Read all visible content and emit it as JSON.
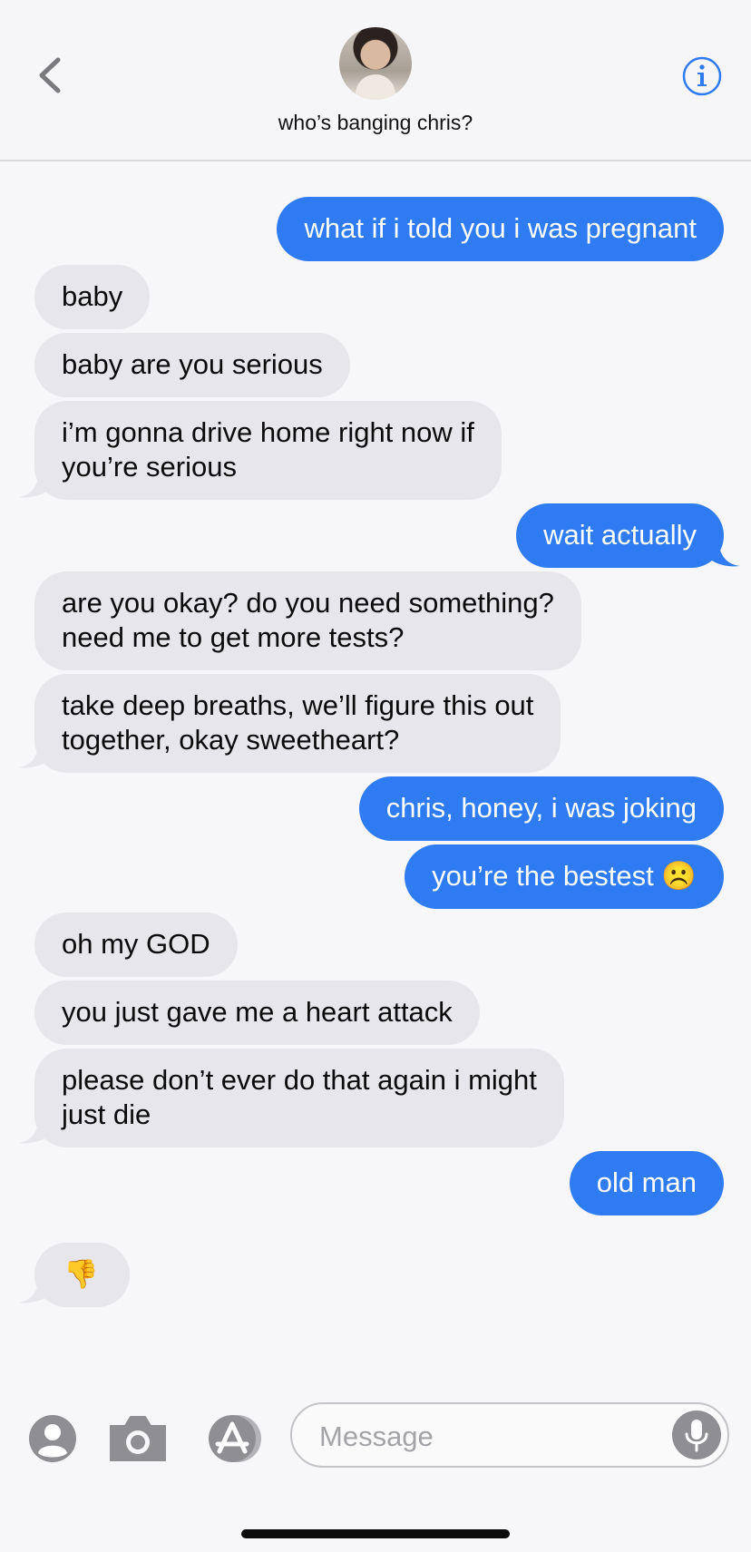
{
  "header": {
    "contact_name": "who’s banging chris?",
    "back_icon": "chevron-left-icon",
    "info_icon": "info-icon"
  },
  "messages": [
    {
      "dir": "out",
      "text": "what if i told you i was pregnant"
    },
    {
      "dir": "in",
      "text": "baby"
    },
    {
      "dir": "in",
      "text": "baby are you serious"
    },
    {
      "dir": "in",
      "text": "i’m gonna drive home right now if\nyou’re serious"
    },
    {
      "dir": "out",
      "text": "wait actually"
    },
    {
      "dir": "in",
      "text": "are you okay? do you need something?\nneed me to get more tests?"
    },
    {
      "dir": "in",
      "text": "take deep breaths, we’ll figure this out\ntogether, okay sweetheart?"
    },
    {
      "dir": "out",
      "text": "chris, honey, i was joking"
    },
    {
      "dir": "out",
      "text": "you’re the bestest ☹️"
    },
    {
      "dir": "in",
      "text": "oh my GOD"
    },
    {
      "dir": "in",
      "text": "you just gave me a heart attack"
    },
    {
      "dir": "in",
      "text": "please don’t ever do that again i might\njust die"
    },
    {
      "dir": "out",
      "text": "old man"
    },
    {
      "dir": "in",
      "text": "👎"
    }
  ],
  "input_bar": {
    "placeholder": "Message",
    "icons": [
      "contact-icon",
      "camera-icon",
      "app-store-icon",
      "microphone-icon"
    ]
  },
  "colors": {
    "outgoing": "#2f7bf1",
    "incoming": "#e6e6eb",
    "accent": "#2f7bf1"
  }
}
